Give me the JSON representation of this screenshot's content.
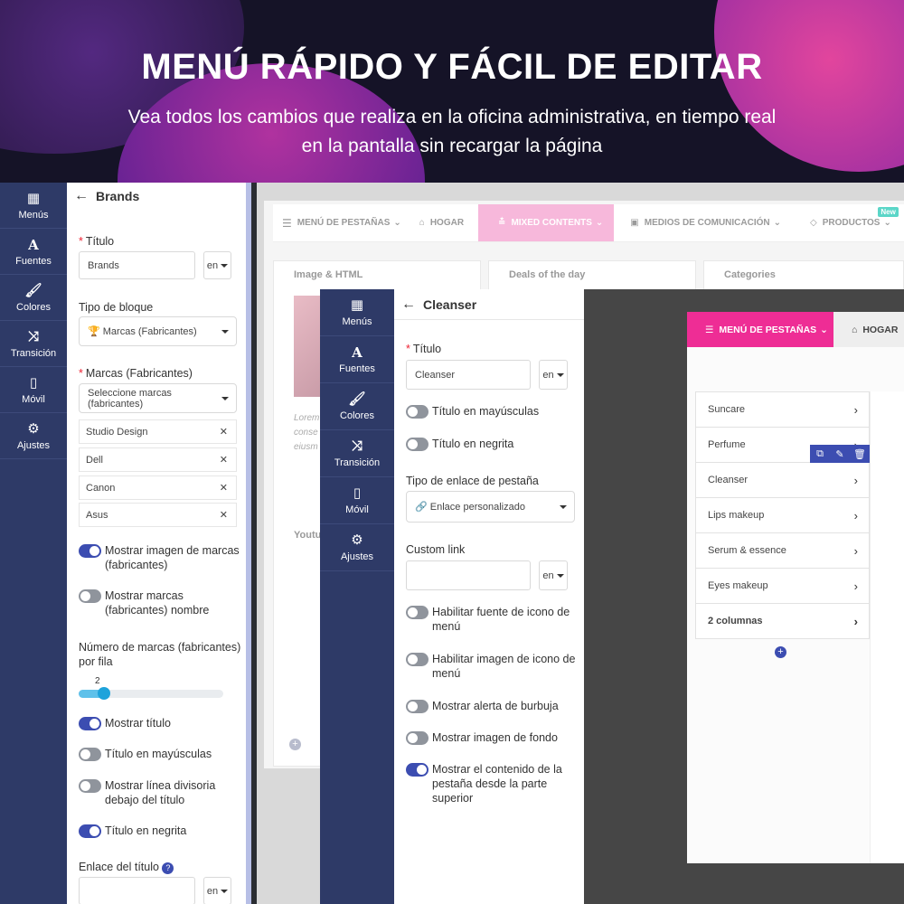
{
  "hero": {
    "title": "MENÚ RÁPIDO Y FÁCIL DE EDITAR",
    "subtitle_line1": "Vea todos los cambios que realiza en la oficina administrativa, en tiempo real",
    "subtitle_line2": "en la pantalla sin recargar la página"
  },
  "sidebar": {
    "items": [
      {
        "label": "Menús",
        "icon": "grid-icon"
      },
      {
        "label": "Fuentes",
        "icon": "font-icon"
      },
      {
        "label": "Colores",
        "icon": "brush-icon"
      },
      {
        "label": "Transición",
        "icon": "shuffle-icon"
      },
      {
        "label": "Móvil",
        "icon": "mobile-icon"
      },
      {
        "label": "Ajustes",
        "icon": "gear-icon"
      }
    ]
  },
  "brands_panel": {
    "header": "Brands",
    "title_label": "Título",
    "title_value": "Brands",
    "lang": "en",
    "block_type_label": "Tipo de bloque",
    "block_type_value": "Marcas (Fabricantes)",
    "brands_label": "Marcas (Fabricantes)",
    "brands_placeholder": "Seleccione marcas (fabricantes)",
    "brands": [
      "Studio Design",
      "Dell",
      "Canon",
      "Asus"
    ],
    "toggle_show_image": "Mostrar imagen de marcas (fabricantes)",
    "toggle_show_name": "Mostrar marcas (fabricantes) nombre",
    "per_row_label": "Número de marcas (fabricantes) por fila",
    "per_row_value": "2",
    "per_row_fraction": 0.13,
    "toggle_show_title": "Mostrar título",
    "toggle_uppercase": "Título en mayúsculas",
    "toggle_divider": "Mostrar línea divisoria debajo del título",
    "toggle_bold": "Título en negrita",
    "title_link_label": "Enlace del título",
    "help": "?"
  },
  "store_nav": {
    "items": [
      "MENÚ DE PESTAÑAS",
      "HOGAR",
      "MIXED CONTENTS",
      "MEDIOS DE COMUNICACIÓN",
      "PRODUCTOS"
    ],
    "new_badge": "New"
  },
  "store_cards": {
    "image_html": "Image & HTML",
    "deals": "Deals of the day",
    "categories": "Categories",
    "lorem1": "Lorem",
    "lorem2": "conse",
    "lorem3": "eiusm",
    "youtube": "Youtu"
  },
  "cleanser_panel": {
    "header": "Cleanser",
    "title_label": "Título",
    "title_value": "Cleanser",
    "lang": "en",
    "toggle_uppercase": "Título en mayúsculas",
    "toggle_bold": "Título en negrita",
    "link_type_label": "Tipo de enlace de pestaña",
    "link_type_value": "Enlace personalizado",
    "custom_link_label": "Custom link",
    "toggle_icon_font": "Habilitar fuente de icono de menú",
    "toggle_icon_image": "Habilitar imagen de icono de menú",
    "toggle_bubble": "Mostrar alerta de burbuja",
    "toggle_bg": "Mostrar imagen de fondo",
    "toggle_content": "Mostrar el contenido de la pestaña desde la parte superior"
  },
  "preview": {
    "tab_menu": "MENÚ DE PESTAÑAS",
    "home": "HOGAR",
    "categories": [
      "Suncare",
      "Perfume",
      "Cleanser",
      "Lips makeup",
      "Serum & essence",
      "Eyes makeup",
      "2 columnas"
    ]
  },
  "colors": {
    "sidebar": "#2e3a67",
    "accent": "#3c4db1",
    "pink": "#ee3a9a",
    "tab_pink": "#f7b8db"
  }
}
